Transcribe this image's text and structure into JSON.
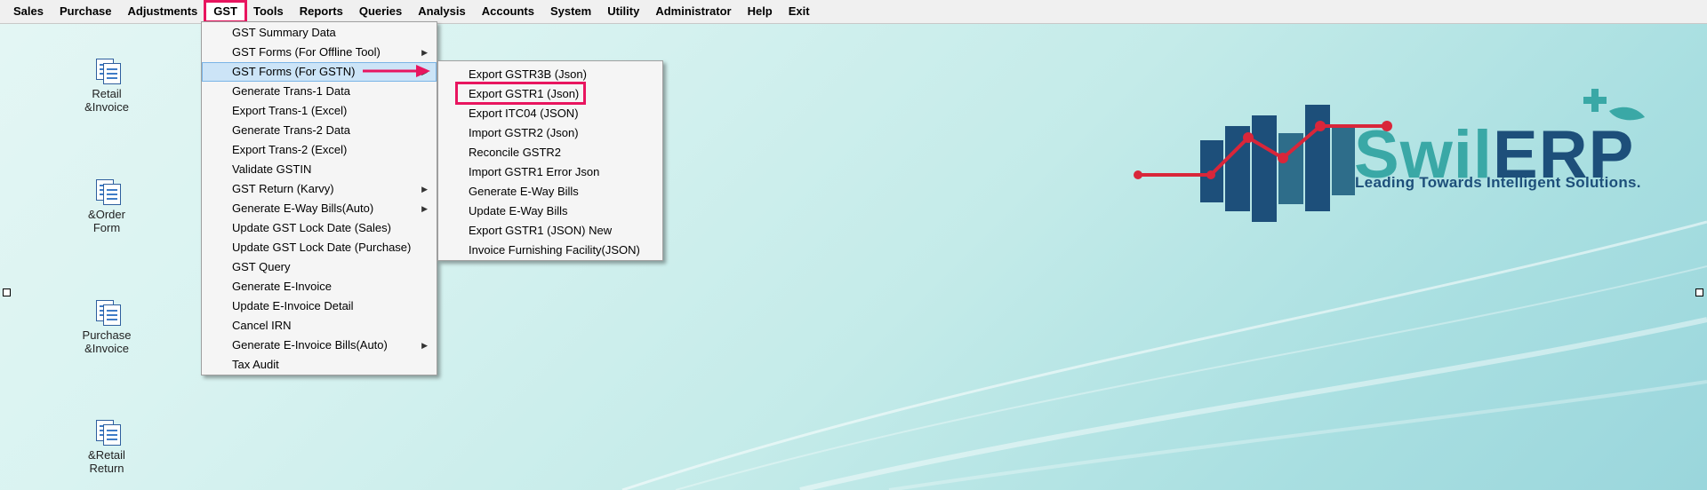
{
  "menubar": {
    "items": [
      {
        "label": "Sales"
      },
      {
        "label": "Purchase"
      },
      {
        "label": "Adjustments"
      },
      {
        "label": "GST",
        "active": true
      },
      {
        "label": "Tools"
      },
      {
        "label": "Reports"
      },
      {
        "label": "Queries"
      },
      {
        "label": "Analysis"
      },
      {
        "label": "Accounts"
      },
      {
        "label": "System"
      },
      {
        "label": "Utility"
      },
      {
        "label": "Administrator"
      },
      {
        "label": "Help"
      },
      {
        "label": "Exit"
      }
    ]
  },
  "desktop_icons": [
    {
      "label": "Retail\n&Invoice",
      "icon": "document-icon"
    },
    {
      "label": "&Order\nForm",
      "icon": "document-icon"
    },
    {
      "label": "Purchase\n&Invoice",
      "icon": "document-icon"
    },
    {
      "label": "&Retail\nReturn",
      "icon": "document-icon"
    }
  ],
  "gst_menu": {
    "items": [
      {
        "label": "GST Summary Data"
      },
      {
        "label": "GST Forms (For Offline Tool)",
        "submenu": true
      },
      {
        "label": "GST Forms (For GSTN)",
        "submenu": true,
        "highlighted": true
      },
      {
        "label": "Generate Trans-1 Data"
      },
      {
        "label": "Export Trans-1 (Excel)"
      },
      {
        "label": "Generate Trans-2 Data"
      },
      {
        "label": "Export Trans-2 (Excel)"
      },
      {
        "label": "Validate GSTIN"
      },
      {
        "label": "GST Return (Karvy)",
        "submenu": true
      },
      {
        "label": "Generate E-Way Bills(Auto)",
        "submenu": true
      },
      {
        "label": "Update GST Lock Date (Sales)"
      },
      {
        "label": "Update GST Lock Date (Purchase)"
      },
      {
        "label": "GST Query"
      },
      {
        "label": "Generate E-Invoice"
      },
      {
        "label": "Update E-Invoice Detail"
      },
      {
        "label": "Cancel IRN"
      },
      {
        "label": "Generate E-Invoice Bills(Auto)",
        "submenu": true
      },
      {
        "label": "Tax Audit"
      }
    ]
  },
  "gstn_submenu": {
    "items": [
      {
        "label": "Export GSTR3B (Json)"
      },
      {
        "label": "Export GSTR1 (Json)",
        "annotated": true
      },
      {
        "label": "Export ITC04 (JSON)"
      },
      {
        "label": "Import GSTR2 (Json)"
      },
      {
        "label": "Reconcile GSTR2"
      },
      {
        "label": "Import GSTR1 Error Json"
      },
      {
        "label": "Generate E-Way Bills"
      },
      {
        "label": "Update E-Way Bills"
      },
      {
        "label": "Export GSTR1 (JSON) New"
      },
      {
        "label": "Invoice Furnishing Facility(JSON)"
      }
    ]
  },
  "logo": {
    "brand_part1": "Swil",
    "brand_part2": "ERP",
    "tagline": "Leading Towards Intelligent Solutions."
  },
  "colors": {
    "annotation": "#e8155f",
    "brand_teal": "#3aa8a6",
    "brand_navy": "#1d4f7a",
    "chart_red": "#d9263a"
  }
}
